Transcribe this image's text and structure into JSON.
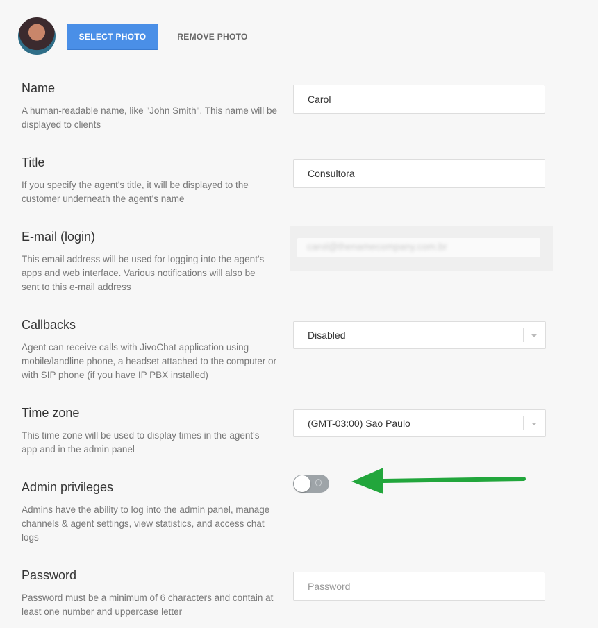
{
  "photo": {
    "select_label": "SELECT PHOTO",
    "remove_label": "REMOVE PHOTO"
  },
  "fields": {
    "name": {
      "label": "Name",
      "description": "A human-readable name, like \"John Smith\". This name will be displayed to clients",
      "value": "Carol"
    },
    "title": {
      "label": "Title",
      "description": "If you specify the agent's title, it will be displayed to the customer underneath the agent's name",
      "value": "Consultora"
    },
    "email": {
      "label": "E-mail (login)",
      "description": "This email address will be used for logging into the agent's apps and web interface. Various notifications will also be sent to this e-mail address",
      "value": "carol@thenamecompany.com.br"
    },
    "callbacks": {
      "label": "Callbacks",
      "description": "Agent can receive calls with JivoChat application using mobile/landline phone, a headset attached to the computer or with SIP phone (if you have IP PBX installed)",
      "value": "Disabled"
    },
    "timezone": {
      "label": "Time zone",
      "description": "This time zone will be used to display times in the agent's app and in the admin panel",
      "value": "(GMT-03:00) Sao Paulo"
    },
    "admin": {
      "label": "Admin privileges",
      "description": "Admins have the ability to log into the admin panel, manage channels & agent settings, view statistics, and access chat logs",
      "enabled": false
    },
    "password": {
      "label": "Password",
      "description": "Password must be a minimum of 6 characters and contain at least one number and uppercase letter",
      "placeholder": "Password"
    }
  },
  "annotation": {
    "arrow_color": "#22a63c"
  },
  "colors": {
    "primary": "#4a8fe7",
    "toggle_off": "#9ea4a8"
  }
}
